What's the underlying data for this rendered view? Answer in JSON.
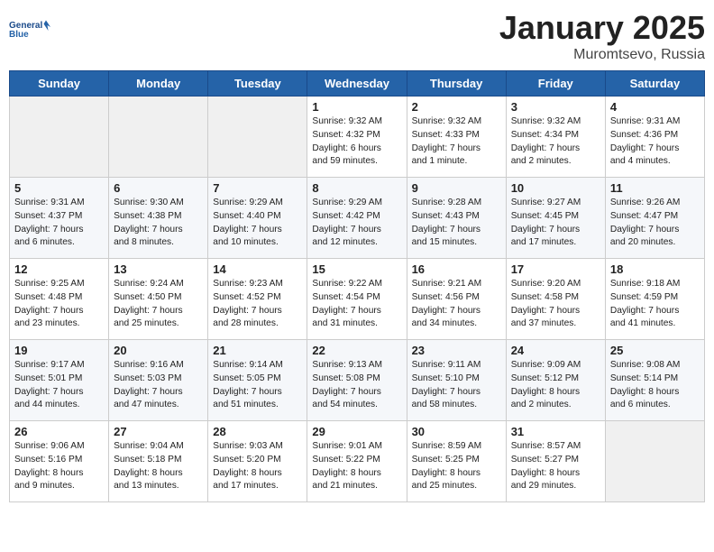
{
  "header": {
    "logo_line1": "General",
    "logo_line2": "Blue",
    "month": "January 2025",
    "location": "Muromtsevo, Russia"
  },
  "days_of_week": [
    "Sunday",
    "Monday",
    "Tuesday",
    "Wednesday",
    "Thursday",
    "Friday",
    "Saturday"
  ],
  "weeks": [
    [
      {
        "day": "",
        "info": ""
      },
      {
        "day": "",
        "info": ""
      },
      {
        "day": "",
        "info": ""
      },
      {
        "day": "1",
        "info": "Sunrise: 9:32 AM\nSunset: 4:32 PM\nDaylight: 6 hours\nand 59 minutes."
      },
      {
        "day": "2",
        "info": "Sunrise: 9:32 AM\nSunset: 4:33 PM\nDaylight: 7 hours\nand 1 minute."
      },
      {
        "day": "3",
        "info": "Sunrise: 9:32 AM\nSunset: 4:34 PM\nDaylight: 7 hours\nand 2 minutes."
      },
      {
        "day": "4",
        "info": "Sunrise: 9:31 AM\nSunset: 4:36 PM\nDaylight: 7 hours\nand 4 minutes."
      }
    ],
    [
      {
        "day": "5",
        "info": "Sunrise: 9:31 AM\nSunset: 4:37 PM\nDaylight: 7 hours\nand 6 minutes."
      },
      {
        "day": "6",
        "info": "Sunrise: 9:30 AM\nSunset: 4:38 PM\nDaylight: 7 hours\nand 8 minutes."
      },
      {
        "day": "7",
        "info": "Sunrise: 9:29 AM\nSunset: 4:40 PM\nDaylight: 7 hours\nand 10 minutes."
      },
      {
        "day": "8",
        "info": "Sunrise: 9:29 AM\nSunset: 4:42 PM\nDaylight: 7 hours\nand 12 minutes."
      },
      {
        "day": "9",
        "info": "Sunrise: 9:28 AM\nSunset: 4:43 PM\nDaylight: 7 hours\nand 15 minutes."
      },
      {
        "day": "10",
        "info": "Sunrise: 9:27 AM\nSunset: 4:45 PM\nDaylight: 7 hours\nand 17 minutes."
      },
      {
        "day": "11",
        "info": "Sunrise: 9:26 AM\nSunset: 4:47 PM\nDaylight: 7 hours\nand 20 minutes."
      }
    ],
    [
      {
        "day": "12",
        "info": "Sunrise: 9:25 AM\nSunset: 4:48 PM\nDaylight: 7 hours\nand 23 minutes."
      },
      {
        "day": "13",
        "info": "Sunrise: 9:24 AM\nSunset: 4:50 PM\nDaylight: 7 hours\nand 25 minutes."
      },
      {
        "day": "14",
        "info": "Sunrise: 9:23 AM\nSunset: 4:52 PM\nDaylight: 7 hours\nand 28 minutes."
      },
      {
        "day": "15",
        "info": "Sunrise: 9:22 AM\nSunset: 4:54 PM\nDaylight: 7 hours\nand 31 minutes."
      },
      {
        "day": "16",
        "info": "Sunrise: 9:21 AM\nSunset: 4:56 PM\nDaylight: 7 hours\nand 34 minutes."
      },
      {
        "day": "17",
        "info": "Sunrise: 9:20 AM\nSunset: 4:58 PM\nDaylight: 7 hours\nand 37 minutes."
      },
      {
        "day": "18",
        "info": "Sunrise: 9:18 AM\nSunset: 4:59 PM\nDaylight: 7 hours\nand 41 minutes."
      }
    ],
    [
      {
        "day": "19",
        "info": "Sunrise: 9:17 AM\nSunset: 5:01 PM\nDaylight: 7 hours\nand 44 minutes."
      },
      {
        "day": "20",
        "info": "Sunrise: 9:16 AM\nSunset: 5:03 PM\nDaylight: 7 hours\nand 47 minutes."
      },
      {
        "day": "21",
        "info": "Sunrise: 9:14 AM\nSunset: 5:05 PM\nDaylight: 7 hours\nand 51 minutes."
      },
      {
        "day": "22",
        "info": "Sunrise: 9:13 AM\nSunset: 5:08 PM\nDaylight: 7 hours\nand 54 minutes."
      },
      {
        "day": "23",
        "info": "Sunrise: 9:11 AM\nSunset: 5:10 PM\nDaylight: 7 hours\nand 58 minutes."
      },
      {
        "day": "24",
        "info": "Sunrise: 9:09 AM\nSunset: 5:12 PM\nDaylight: 8 hours\nand 2 minutes."
      },
      {
        "day": "25",
        "info": "Sunrise: 9:08 AM\nSunset: 5:14 PM\nDaylight: 8 hours\nand 6 minutes."
      }
    ],
    [
      {
        "day": "26",
        "info": "Sunrise: 9:06 AM\nSunset: 5:16 PM\nDaylight: 8 hours\nand 9 minutes."
      },
      {
        "day": "27",
        "info": "Sunrise: 9:04 AM\nSunset: 5:18 PM\nDaylight: 8 hours\nand 13 minutes."
      },
      {
        "day": "28",
        "info": "Sunrise: 9:03 AM\nSunset: 5:20 PM\nDaylight: 8 hours\nand 17 minutes."
      },
      {
        "day": "29",
        "info": "Sunrise: 9:01 AM\nSunset: 5:22 PM\nDaylight: 8 hours\nand 21 minutes."
      },
      {
        "day": "30",
        "info": "Sunrise: 8:59 AM\nSunset: 5:25 PM\nDaylight: 8 hours\nand 25 minutes."
      },
      {
        "day": "31",
        "info": "Sunrise: 8:57 AM\nSunset: 5:27 PM\nDaylight: 8 hours\nand 29 minutes."
      },
      {
        "day": "",
        "info": ""
      }
    ]
  ]
}
